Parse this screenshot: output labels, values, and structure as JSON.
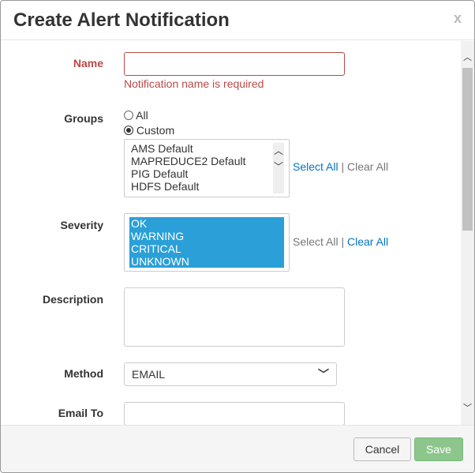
{
  "title": "Create Alert Notification",
  "close": "x",
  "name": {
    "label": "Name",
    "value": "",
    "error": "Notification name is required"
  },
  "groups": {
    "label": "Groups",
    "options": [
      "All",
      "Custom"
    ],
    "selected": "Custom",
    "items": [
      "AMS Default",
      "MAPREDUCE2 Default",
      "PIG Default",
      "HDFS Default"
    ],
    "select_all": "Select All",
    "sep": "|",
    "clear_all": "Clear All"
  },
  "severity": {
    "label": "Severity",
    "items": [
      "OK",
      "WARNING",
      "CRITICAL",
      "UNKNOWN"
    ],
    "select_all": "Select All",
    "sep": "|",
    "clear_all": "Clear All"
  },
  "description": {
    "label": "Description",
    "value": ""
  },
  "method": {
    "label": "Method",
    "value": "EMAIL"
  },
  "email_to": {
    "label": "Email To",
    "value": ""
  },
  "footer": {
    "cancel": "Cancel",
    "save": "Save"
  },
  "colors": {
    "error": "#b94a48",
    "selected": "#2a9fd8",
    "save": "#8cc68c"
  }
}
